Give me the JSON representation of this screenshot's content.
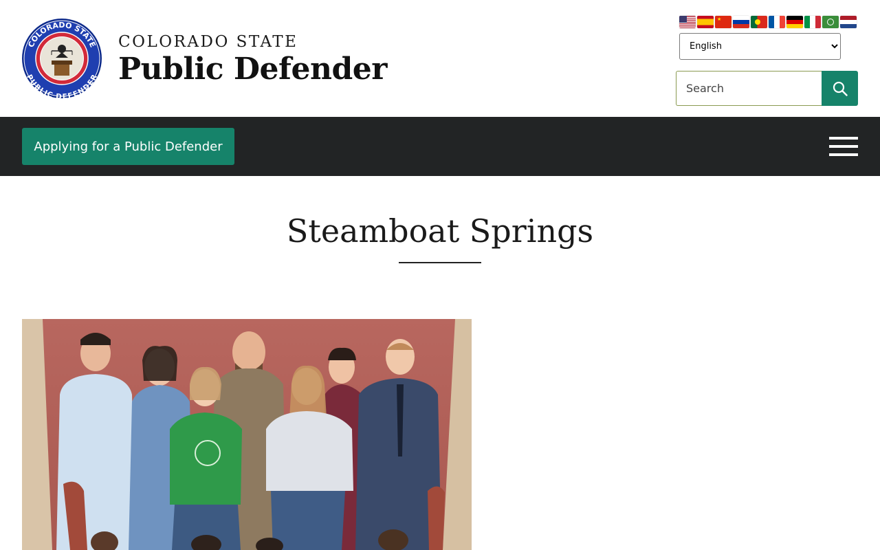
{
  "header": {
    "logo_alt": "Colorado State Public Defender seal",
    "seal_top": "COLORADO STATE",
    "seal_bottom": "PUBLIC DEFENDER",
    "seal_motto": "THAT JUSTICE ESCAPE NONE",
    "site_subtitle": "COLORADO STATE",
    "site_title": "Public Defender"
  },
  "language": {
    "flags": [
      "us-flag-icon",
      "es-flag-icon",
      "cn-flag-icon",
      "ru-flag-icon",
      "pt-flag-icon",
      "fr-flag-icon",
      "de-flag-icon",
      "it-flag-icon",
      "ar-flag-icon",
      "nl-flag-icon"
    ],
    "selected": "English"
  },
  "search": {
    "placeholder": "Search",
    "button_icon": "search-icon"
  },
  "nav": {
    "apply_label": "Applying for a Public Defender",
    "menu_icon": "hamburger-menu-icon"
  },
  "page": {
    "title": "Steamboat Springs",
    "photo_alt": "Steamboat Springs office staff group photo"
  },
  "colors": {
    "accent": "#16836a",
    "navbar": "#222425"
  }
}
